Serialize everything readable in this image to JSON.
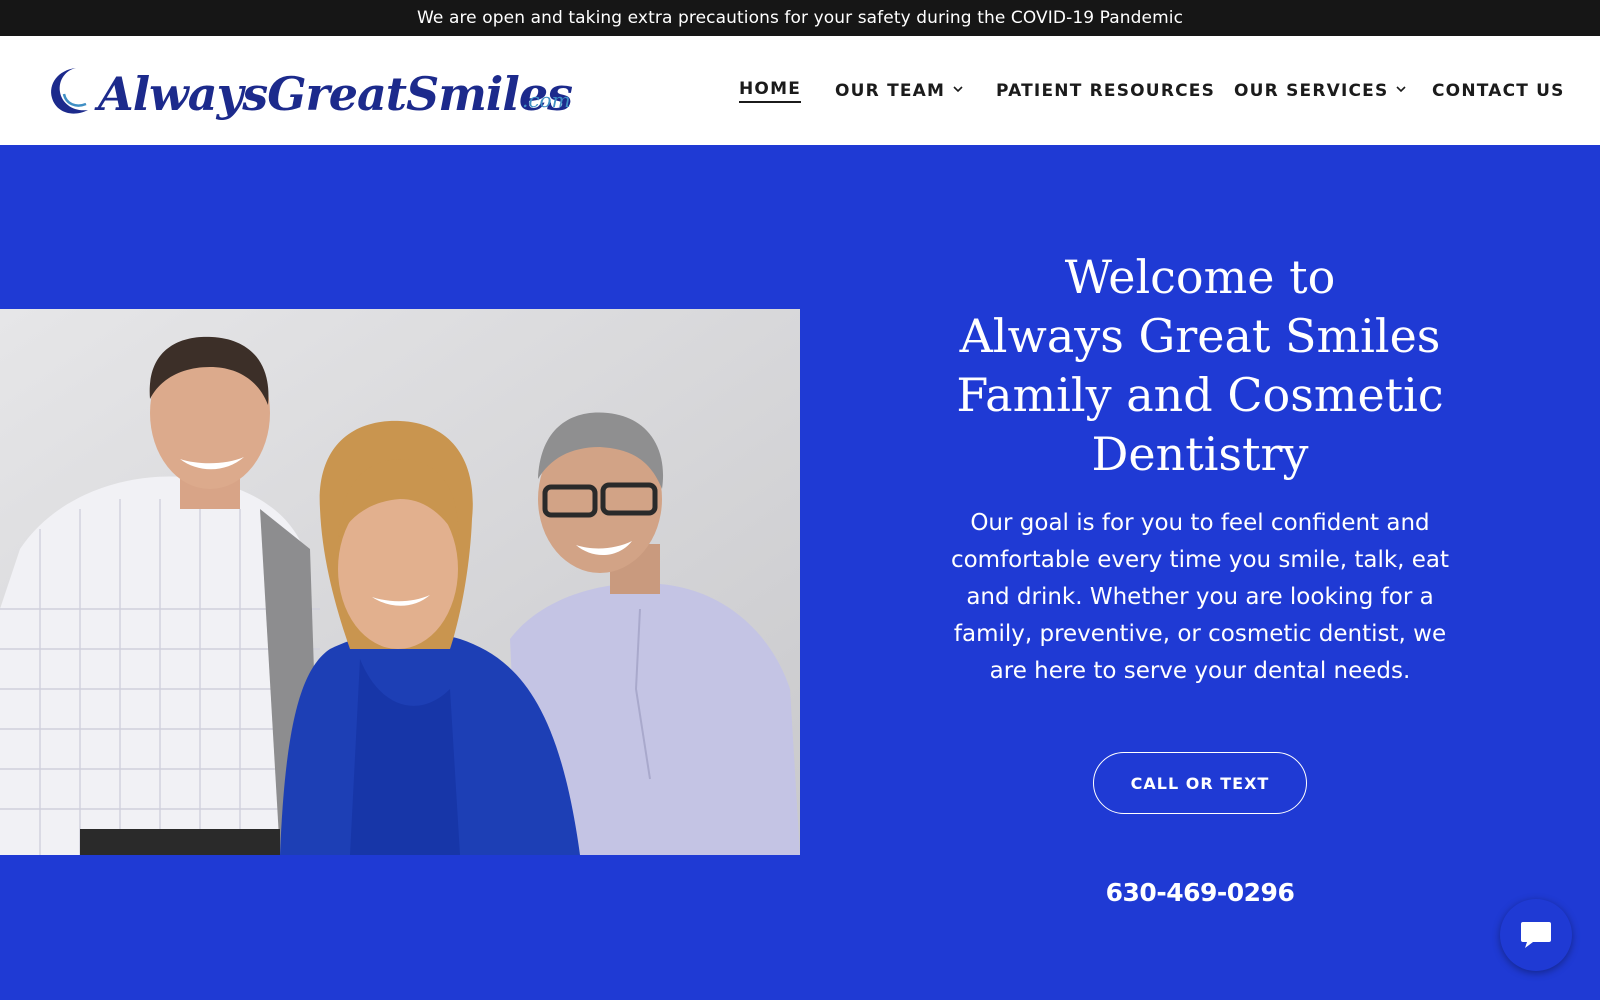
{
  "banner": {
    "text": "We are open and taking extra precautions for your safety during the COVID-19 Pandemic"
  },
  "logo": {
    "main": "AlwaysGreatSmiles",
    "tld": ".com"
  },
  "nav": {
    "items": [
      {
        "label": "HOME",
        "active": true,
        "dropdown": false
      },
      {
        "label": "OUR TEAM",
        "active": false,
        "dropdown": true
      },
      {
        "label": "PATIENT RESOURCES",
        "active": false,
        "dropdown": false
      },
      {
        "label": "OUR SERVICES",
        "active": false,
        "dropdown": true
      },
      {
        "label": "CONTACT US",
        "active": false,
        "dropdown": false
      }
    ]
  },
  "hero": {
    "title_lines": [
      "Welcome to",
      "Always Great Smiles",
      "Family and Cosmetic",
      "Dentistry"
    ],
    "description": "Our goal is for you to feel confident and comfortable every time you smile, talk, eat and drink.  Whether you are looking for a family, preventive, or cosmetic dentist, we are here to serve your dental needs.",
    "cta_label": "CALL OR TEXT",
    "phone": "630-469-0296",
    "photo_icon": "team-photo"
  },
  "chat": {
    "icon": "chat-bubble-icon"
  },
  "colors": {
    "banner_bg": "#161616",
    "hero_bg": "#1f3ad4",
    "logo_text": "#1c2a8c",
    "logo_tld": "#3f8fc4",
    "nav_text": "#1b1b1b"
  }
}
